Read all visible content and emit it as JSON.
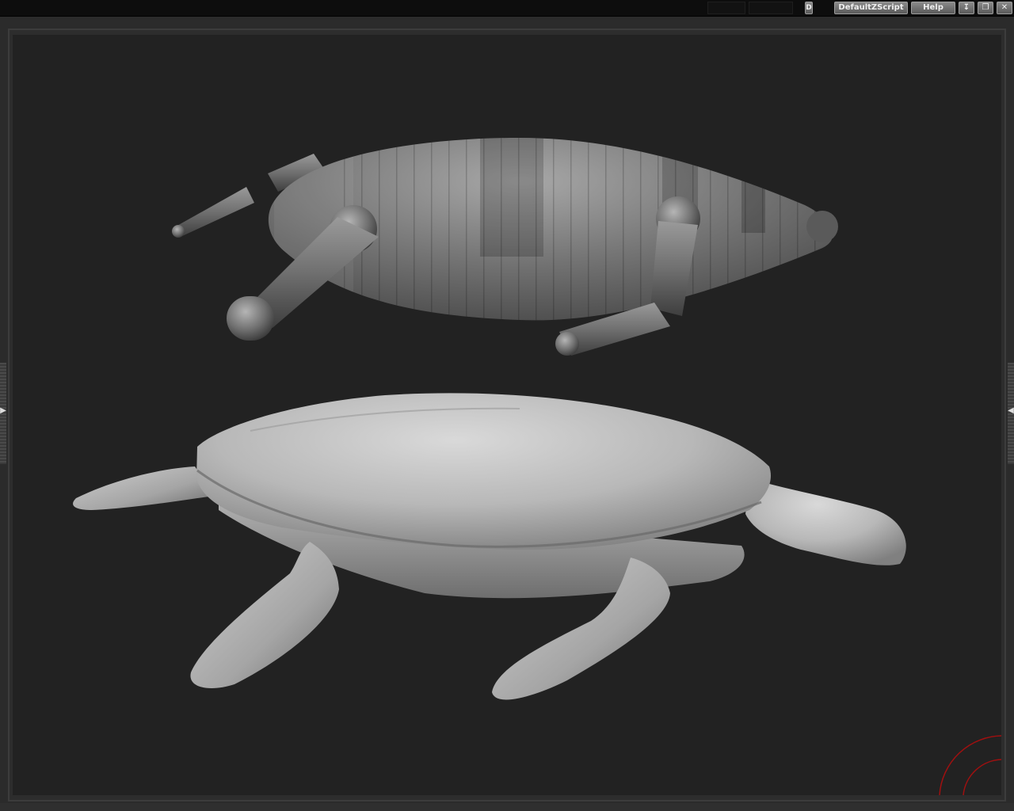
{
  "topbar": {
    "truncated_label": "D",
    "script_button": "DefaultZScript",
    "help_button": "Help"
  },
  "window_controls": {
    "minimize_icon": "minimize-icon",
    "restore_icon": "restore-icon",
    "close_icon": "close-icon"
  },
  "viewport": {
    "background": "#222222",
    "models": [
      "zsphere-armature",
      "sculpted-sea-turtle"
    ],
    "axis_gizmo_color": "#a01010"
  }
}
